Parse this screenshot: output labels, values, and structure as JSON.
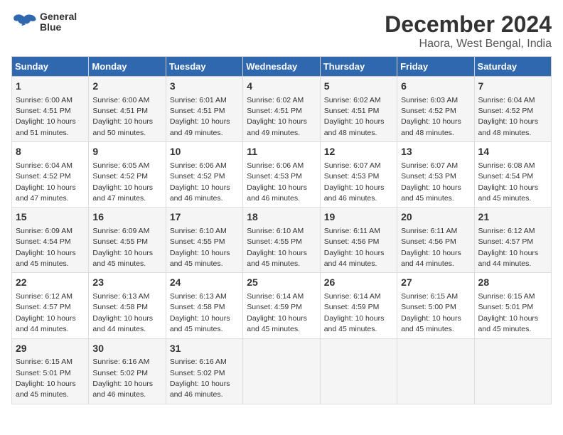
{
  "logo": {
    "line1": "General",
    "line2": "Blue"
  },
  "title": "December 2024",
  "location": "Haora, West Bengal, India",
  "days_of_week": [
    "Sunday",
    "Monday",
    "Tuesday",
    "Wednesday",
    "Thursday",
    "Friday",
    "Saturday"
  ],
  "weeks": [
    [
      {
        "day": "1",
        "sunrise": "6:00 AM",
        "sunset": "4:51 PM",
        "daylight": "10 hours and 51 minutes."
      },
      {
        "day": "2",
        "sunrise": "6:00 AM",
        "sunset": "4:51 PM",
        "daylight": "10 hours and 50 minutes."
      },
      {
        "day": "3",
        "sunrise": "6:01 AM",
        "sunset": "4:51 PM",
        "daylight": "10 hours and 49 minutes."
      },
      {
        "day": "4",
        "sunrise": "6:02 AM",
        "sunset": "4:51 PM",
        "daylight": "10 hours and 49 minutes."
      },
      {
        "day": "5",
        "sunrise": "6:02 AM",
        "sunset": "4:51 PM",
        "daylight": "10 hours and 48 minutes."
      },
      {
        "day": "6",
        "sunrise": "6:03 AM",
        "sunset": "4:52 PM",
        "daylight": "10 hours and 48 minutes."
      },
      {
        "day": "7",
        "sunrise": "6:04 AM",
        "sunset": "4:52 PM",
        "daylight": "10 hours and 48 minutes."
      }
    ],
    [
      {
        "day": "8",
        "sunrise": "6:04 AM",
        "sunset": "4:52 PM",
        "daylight": "10 hours and 47 minutes."
      },
      {
        "day": "9",
        "sunrise": "6:05 AM",
        "sunset": "4:52 PM",
        "daylight": "10 hours and 47 minutes."
      },
      {
        "day": "10",
        "sunrise": "6:06 AM",
        "sunset": "4:52 PM",
        "daylight": "10 hours and 46 minutes."
      },
      {
        "day": "11",
        "sunrise": "6:06 AM",
        "sunset": "4:53 PM",
        "daylight": "10 hours and 46 minutes."
      },
      {
        "day": "12",
        "sunrise": "6:07 AM",
        "sunset": "4:53 PM",
        "daylight": "10 hours and 46 minutes."
      },
      {
        "day": "13",
        "sunrise": "6:07 AM",
        "sunset": "4:53 PM",
        "daylight": "10 hours and 45 minutes."
      },
      {
        "day": "14",
        "sunrise": "6:08 AM",
        "sunset": "4:54 PM",
        "daylight": "10 hours and 45 minutes."
      }
    ],
    [
      {
        "day": "15",
        "sunrise": "6:09 AM",
        "sunset": "4:54 PM",
        "daylight": "10 hours and 45 minutes."
      },
      {
        "day": "16",
        "sunrise": "6:09 AM",
        "sunset": "4:55 PM",
        "daylight": "10 hours and 45 minutes."
      },
      {
        "day": "17",
        "sunrise": "6:10 AM",
        "sunset": "4:55 PM",
        "daylight": "10 hours and 45 minutes."
      },
      {
        "day": "18",
        "sunrise": "6:10 AM",
        "sunset": "4:55 PM",
        "daylight": "10 hours and 45 minutes."
      },
      {
        "day": "19",
        "sunrise": "6:11 AM",
        "sunset": "4:56 PM",
        "daylight": "10 hours and 44 minutes."
      },
      {
        "day": "20",
        "sunrise": "6:11 AM",
        "sunset": "4:56 PM",
        "daylight": "10 hours and 44 minutes."
      },
      {
        "day": "21",
        "sunrise": "6:12 AM",
        "sunset": "4:57 PM",
        "daylight": "10 hours and 44 minutes."
      }
    ],
    [
      {
        "day": "22",
        "sunrise": "6:12 AM",
        "sunset": "4:57 PM",
        "daylight": "10 hours and 44 minutes."
      },
      {
        "day": "23",
        "sunrise": "6:13 AM",
        "sunset": "4:58 PM",
        "daylight": "10 hours and 44 minutes."
      },
      {
        "day": "24",
        "sunrise": "6:13 AM",
        "sunset": "4:58 PM",
        "daylight": "10 hours and 45 minutes."
      },
      {
        "day": "25",
        "sunrise": "6:14 AM",
        "sunset": "4:59 PM",
        "daylight": "10 hours and 45 minutes."
      },
      {
        "day": "26",
        "sunrise": "6:14 AM",
        "sunset": "4:59 PM",
        "daylight": "10 hours and 45 minutes."
      },
      {
        "day": "27",
        "sunrise": "6:15 AM",
        "sunset": "5:00 PM",
        "daylight": "10 hours and 45 minutes."
      },
      {
        "day": "28",
        "sunrise": "6:15 AM",
        "sunset": "5:01 PM",
        "daylight": "10 hours and 45 minutes."
      }
    ],
    [
      {
        "day": "29",
        "sunrise": "6:15 AM",
        "sunset": "5:01 PM",
        "daylight": "10 hours and 45 minutes."
      },
      {
        "day": "30",
        "sunrise": "6:16 AM",
        "sunset": "5:02 PM",
        "daylight": "10 hours and 46 minutes."
      },
      {
        "day": "31",
        "sunrise": "6:16 AM",
        "sunset": "5:02 PM",
        "daylight": "10 hours and 46 minutes."
      },
      null,
      null,
      null,
      null
    ]
  ],
  "labels": {
    "sunrise": "Sunrise:",
    "sunset": "Sunset:",
    "daylight": "Daylight:"
  }
}
